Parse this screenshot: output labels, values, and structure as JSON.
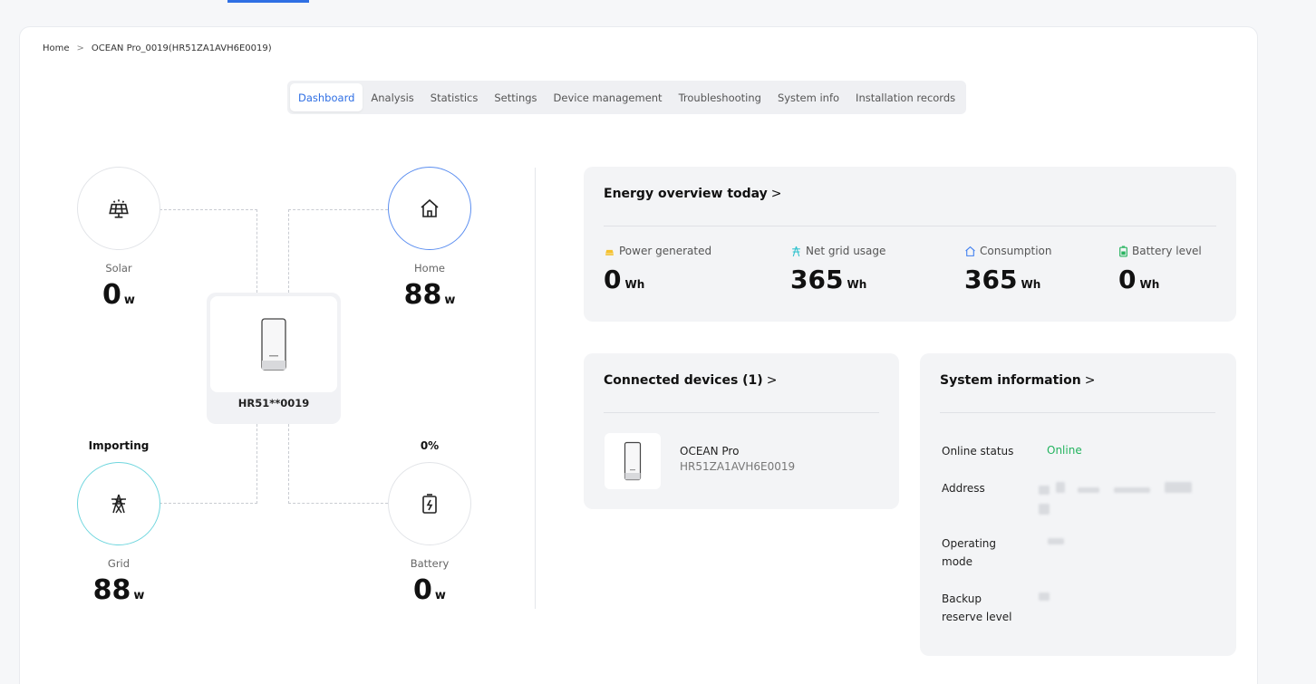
{
  "breadcrumb": {
    "home": "Home",
    "separator": ">",
    "current": "OCEAN Pro_0019(HR51ZA1AVH6E0019)"
  },
  "tabs": [
    {
      "label": "Dashboard",
      "active": true
    },
    {
      "label": "Analysis"
    },
    {
      "label": "Statistics"
    },
    {
      "label": "Settings"
    },
    {
      "label": "Device management"
    },
    {
      "label": "Troubleshooting"
    },
    {
      "label": "System info"
    },
    {
      "label": "Installation records"
    }
  ],
  "flow": {
    "solar": {
      "label": "Solar",
      "value": "0",
      "unit": "w",
      "icon": "solar-panel-icon"
    },
    "home": {
      "label": "Home",
      "value": "88",
      "unit": "w",
      "icon": "house-icon"
    },
    "grid": {
      "label": "Grid",
      "value": "88",
      "unit": "w",
      "state": "Importing",
      "icon": "power-tower-icon"
    },
    "battery": {
      "label": "Battery",
      "value": "0",
      "unit": "w",
      "state": "0%",
      "icon": "battery-charge-icon"
    },
    "inverter": {
      "name": "HR51**0019",
      "icon": "inverter-icon"
    }
  },
  "energy_overview": {
    "title": "Energy overview today",
    "chevron": ">",
    "metrics": [
      {
        "label": "Power generated",
        "value": "0",
        "unit": "Wh",
        "icon": "sun-icon",
        "color": "#f5c12e"
      },
      {
        "label": "Net grid usage",
        "value": "365",
        "unit": "Wh",
        "icon": "grid-tower-icon",
        "color": "#35c3cf"
      },
      {
        "label": "Consumption",
        "value": "365",
        "unit": "Wh",
        "icon": "home-small-icon",
        "color": "#3e7ef0"
      },
      {
        "label": "Battery level",
        "value": "0",
        "unit": "Wh",
        "icon": "battery-icon",
        "color": "#27b35f"
      }
    ]
  },
  "connected_devices": {
    "title": "Connected devices (1)",
    "chevron": ">",
    "device": {
      "name": "OCEAN Pro",
      "serial": "HR51ZA1AVH6E0019"
    }
  },
  "system_information": {
    "title": "System information",
    "chevron": ">",
    "online_status_label": "Online status",
    "online_status_value": "Online",
    "address_label": "Address",
    "operating_mode_label": "Operating mode",
    "backup_reserve_label": "Backup reserve level"
  },
  "colors": {
    "accent": "#2f6fe4",
    "online": "#22b35e"
  }
}
